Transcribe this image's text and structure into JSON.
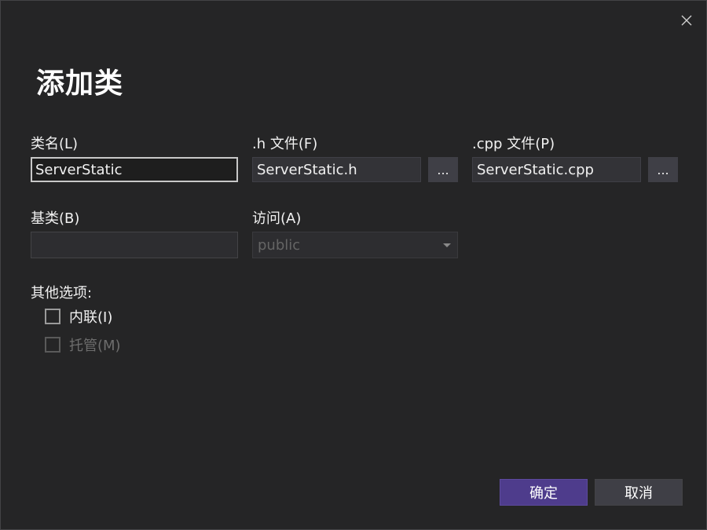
{
  "dialog": {
    "title": "添加类"
  },
  "fields": {
    "class_name": {
      "label": "类名(L)",
      "value": "ServerStatic"
    },
    "h_file": {
      "label": ".h 文件(F)",
      "value": "ServerStatic.h",
      "browse_label": "..."
    },
    "cpp_file": {
      "label": ".cpp 文件(P)",
      "value": "ServerStatic.cpp",
      "browse_label": "..."
    },
    "base_class": {
      "label": "基类(B)",
      "value": ""
    },
    "access": {
      "label": "访问(A)",
      "selected": "public"
    }
  },
  "options": {
    "label": "其他选项:",
    "inline": {
      "label": "内联(I)",
      "checked": false,
      "enabled": true
    },
    "managed": {
      "label": "托管(M)",
      "checked": false,
      "enabled": false
    }
  },
  "buttons": {
    "ok": "确定",
    "cancel": "取消"
  },
  "icons": {
    "close": "close-icon",
    "dropdown": "chevron-down-icon"
  },
  "colors": {
    "background": "#252526",
    "primary_button": "#4e3c8c",
    "secondary_button": "#3f3f46",
    "input_border_focused": "#c8c8c8"
  }
}
